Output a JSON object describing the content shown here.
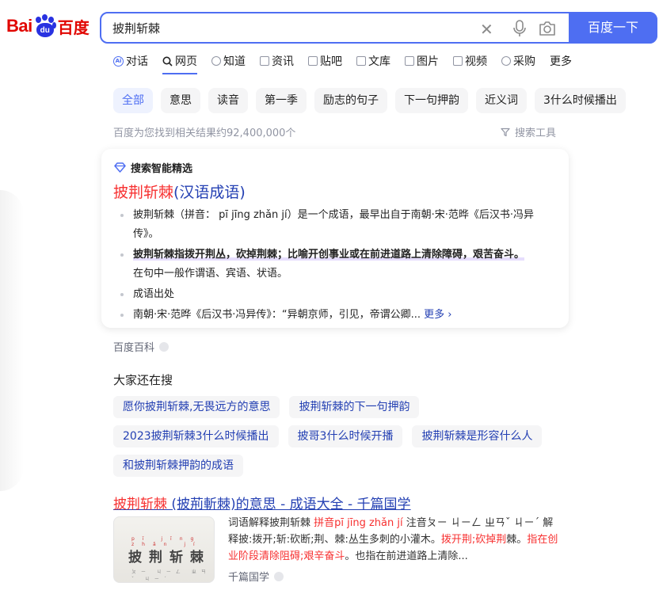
{
  "logo": {
    "bai": "Bai",
    "du": "du",
    "cn": "百度"
  },
  "search": {
    "query": "披荆斩棘",
    "button_label": "百度一下"
  },
  "nav": {
    "tabs": [
      {
        "label": "对话",
        "icon": "ai-chat-icon"
      },
      {
        "label": "网页",
        "icon": "search-icon",
        "active": true
      },
      {
        "label": "知道",
        "icon": "question-icon"
      },
      {
        "label": "资讯",
        "icon": "news-icon"
      },
      {
        "label": "贴吧",
        "icon": "tieba-icon"
      },
      {
        "label": "文库",
        "icon": "document-icon"
      },
      {
        "label": "图片",
        "icon": "image-icon"
      },
      {
        "label": "视频",
        "icon": "video-icon"
      },
      {
        "label": "采购",
        "icon": "cart-icon"
      },
      {
        "label": "更多",
        "icon": ""
      }
    ]
  },
  "chips": [
    "全部",
    "意思",
    "读音",
    "第一季",
    "励志的句子",
    "下一句押韵",
    "近义词",
    "3什么时候播出"
  ],
  "result_count": "百度为您找到相关结果约92,400,000个",
  "search_tools": "搜索工具",
  "smart_card": {
    "header": "搜索智能精选",
    "title_hl": "披荆斩棘",
    "title_rest": "(汉语成语)",
    "items": [
      {
        "text": "披荆斩棘（拼音： pī jīng zhǎn jí）是一个成语，最早出自于南朝·宋·范晔《后汉书·冯异传》。"
      },
      {
        "strong": "披荆斩棘指拨开荆丛，砍掉荆棘；比喻开创事业或在前进道路上清除障碍，艰苦奋斗。",
        "text": "在句中一般作谓语、宾语、状语。"
      },
      {
        "text": "成语出处"
      },
      {
        "text": "南朝·宋·范晔《后汉书·冯异传》：“异朝京师，引见，帝谓公卿...",
        "more": "更多 ›"
      }
    ]
  },
  "card_source": "百度百科",
  "also_search": {
    "title": "大家还在搜",
    "rows": [
      [
        "愿你披荆斩棘,无畏远方的意思",
        "披荆斩棘的下一句押韵"
      ],
      [
        "2023披荆斩棘3什么时候播出",
        "披哥3什么时候开播",
        "披荆斩棘是形容什么人"
      ],
      [
        "和披荆斩棘押韵的成语"
      ]
    ]
  },
  "result": {
    "title_hl": "披荆斩棘",
    "title_rest": " (披荊斬棘)的意思 - 成语大全 - 千篇国学",
    "thumb_pinyin": "pī jīng zhǎn jí",
    "thumb_chars": "披荆斩棘",
    "thumb_bopomofo": "ㄆㄧ ㄐㄧㄥ ㄓㄢˇ ㄐㄧˊ",
    "body_1": "词语解释披荆斩棘 ",
    "body_red1": "拼音pī jīng zhǎn jí",
    "body_2": " 注音ㄆㄧ ㄐㄧㄥ ㄓㄢˇ ㄐㄧˊ 解释披:拨开;斩:砍断;荆、棘:丛生多刺的小灌木。",
    "body_red2": "拨开荆;砍掉荆",
    "body_3": "棘。",
    "body_red3": "指在创业阶段清除阻碍;艰辛奋斗",
    "body_4": "。也指在前进道路上清除...",
    "source": "千篇国学"
  }
}
